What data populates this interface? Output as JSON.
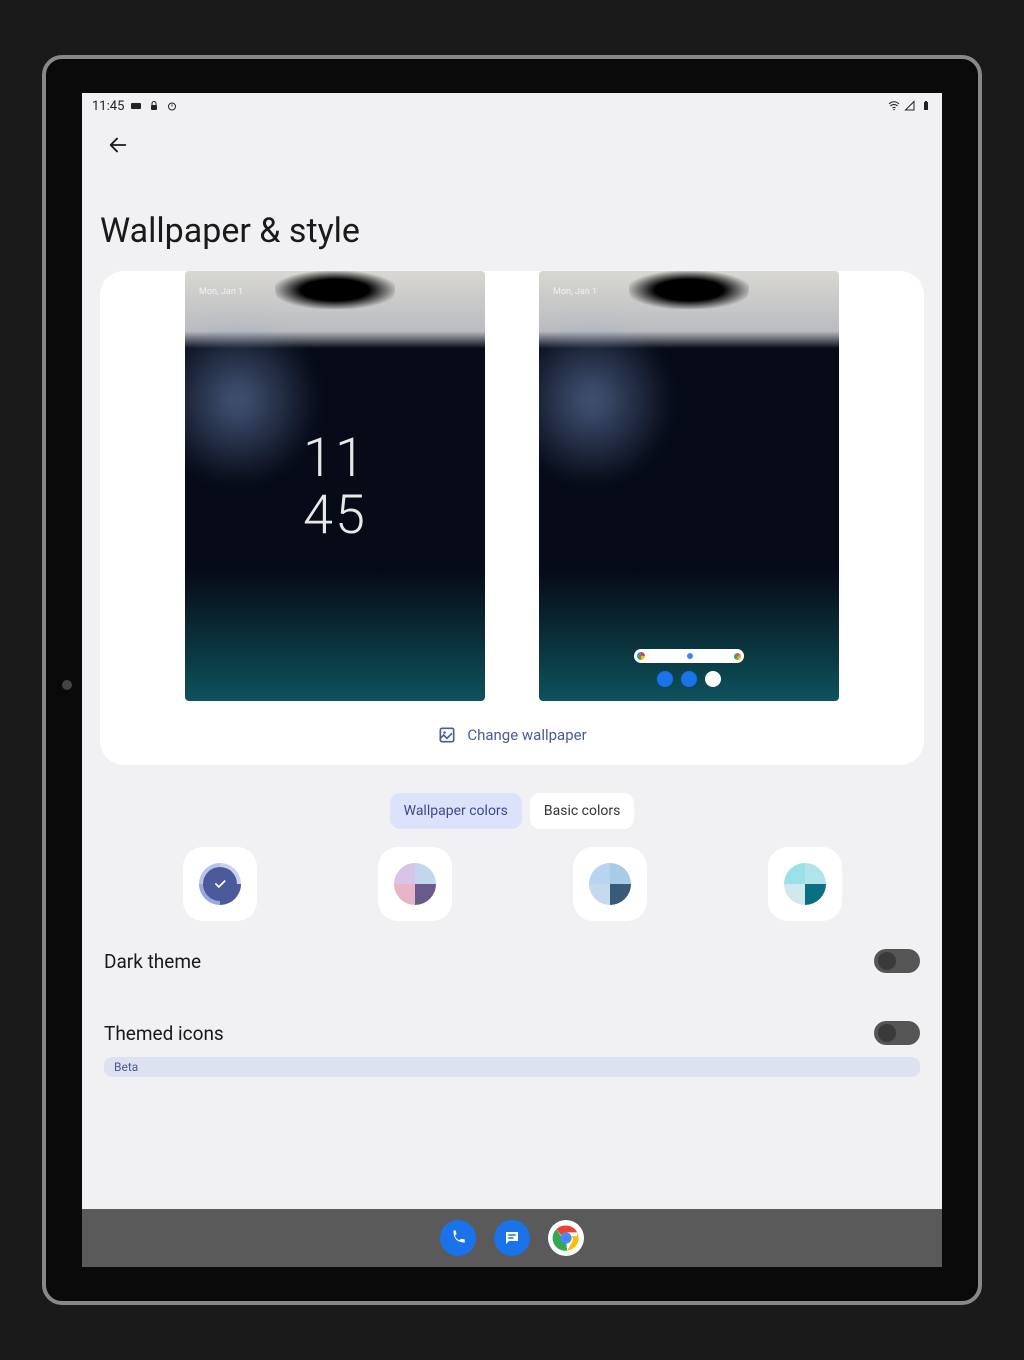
{
  "status": {
    "time": "11:45",
    "icons_left": [
      "keyboard-icon",
      "lock-icon",
      "timer-icon"
    ],
    "icons_right": [
      "wifi-icon",
      "signal-icon",
      "battery-icon"
    ]
  },
  "title": "Wallpaper & style",
  "preview": {
    "lock_time_top": "11",
    "lock_time_bottom": "45",
    "change_label": "Change wallpaper"
  },
  "tabs": [
    {
      "label": "Wallpaper colors",
      "active": true
    },
    {
      "label": "Basic colors",
      "active": false
    }
  ],
  "swatches": [
    {
      "selected": true,
      "colors": [
        "#4a5a9a",
        "#4a5a9a",
        "#4a5a9a",
        "#4a5a9a"
      ]
    },
    {
      "selected": false,
      "colors": [
        "#d8c4e8",
        "#c2d6ee",
        "#e8b4c8",
        "#6a5a8a"
      ]
    },
    {
      "selected": false,
      "colors": [
        "#b8d4ee",
        "#a8cce8",
        "#c4d8ee",
        "#3a5a7a"
      ]
    },
    {
      "selected": false,
      "colors": [
        "#9ae0e8",
        "#b0e4ea",
        "#d0e8ee",
        "#0a7080"
      ]
    }
  ],
  "settings": {
    "dark_theme": {
      "label": "Dark theme",
      "on": false
    },
    "themed_icons": {
      "label": "Themed icons",
      "badge": "Beta",
      "on": false
    }
  },
  "taskbar": [
    "phone",
    "messages",
    "chrome"
  ]
}
